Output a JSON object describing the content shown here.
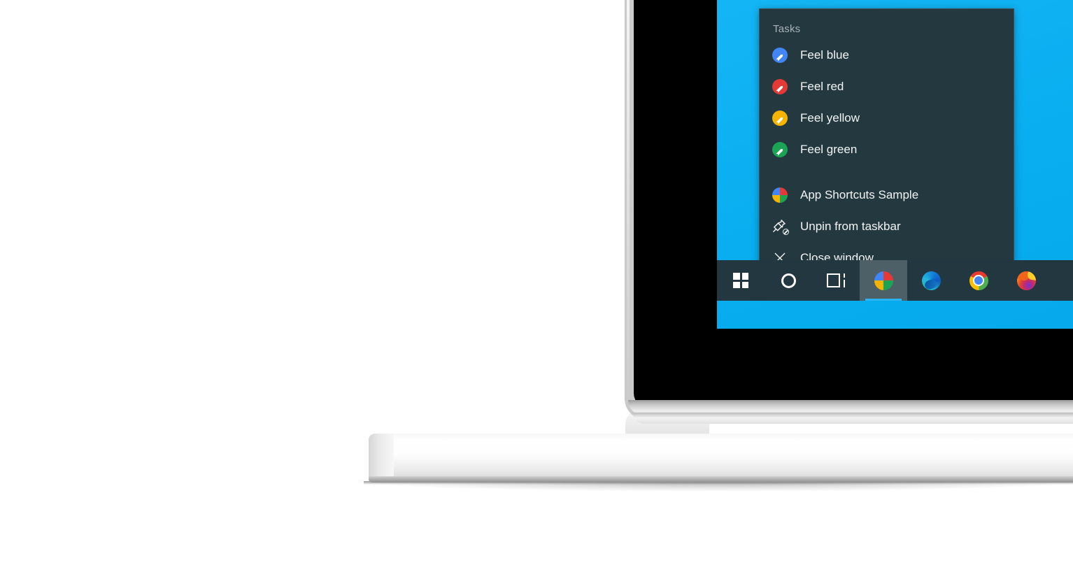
{
  "desktop": {
    "wallpaper_color": "#0fb2f2"
  },
  "jumplist": {
    "header": "Tasks",
    "background_color": "#24383f",
    "tasks": [
      {
        "label": "Feel blue",
        "icon": "pencil-circle-blue-icon",
        "color": "#4285f4"
      },
      {
        "label": "Feel red",
        "icon": "pencil-circle-red-icon",
        "color": "#e53935"
      },
      {
        "label": "Feel yellow",
        "icon": "pencil-circle-yellow-icon",
        "color": "#f5b400"
      },
      {
        "label": "Feel green",
        "icon": "pencil-circle-green-icon",
        "color": "#1aa453"
      }
    ],
    "actions": [
      {
        "label": "App Shortcuts Sample",
        "icon": "app-pie-icon"
      },
      {
        "label": "Unpin from taskbar",
        "icon": "unpin-icon"
      },
      {
        "label": "Close window",
        "icon": "close-icon"
      }
    ]
  },
  "taskbar": {
    "background_color": "#223740",
    "active_highlight_color": "#4d6068",
    "active_indicator_color": "#2ab4f5",
    "buttons": [
      {
        "name": "start",
        "label": "Start",
        "icon": "windows-logo-icon",
        "active": false
      },
      {
        "name": "cortana",
        "label": "Cortana",
        "icon": "circle-icon",
        "active": false
      },
      {
        "name": "task-view",
        "label": "Task View",
        "icon": "task-view-icon",
        "active": false
      },
      {
        "name": "app-shortcuts",
        "label": "App Shortcuts Sample",
        "icon": "app-pie-icon",
        "active": true
      },
      {
        "name": "microsoft-edge",
        "label": "Microsoft Edge",
        "icon": "edge-icon",
        "active": false
      },
      {
        "name": "google-chrome",
        "label": "Google Chrome",
        "icon": "chrome-icon",
        "active": false
      },
      {
        "name": "mozilla-firefox",
        "label": "Mozilla Firefox",
        "icon": "firefox-icon",
        "active": false
      }
    ]
  },
  "app_icon_quadrants": {
    "top_left": "#4285f4",
    "top_right": "#e53935",
    "bottom_left": "#f5b400",
    "bottom_right": "#1aa453"
  }
}
